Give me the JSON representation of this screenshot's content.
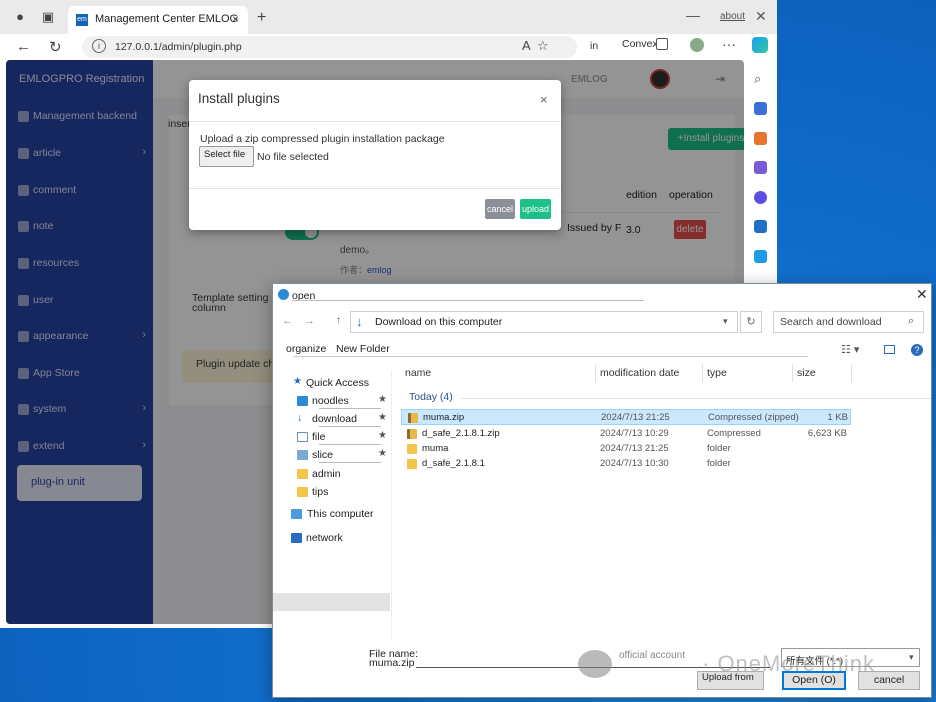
{
  "browser": {
    "tab_title": "Management Center EMLOG",
    "tab_favicon": "em",
    "window_about": "about",
    "url": "127.0.0.1/admin/plugin.php",
    "nav_in": "in",
    "nav_convex": "Convex"
  },
  "sidebar": {
    "title": "EMLOGPRO Registration",
    "items": [
      {
        "label": "Management backend"
      },
      {
        "label": "article",
        "chev": "›"
      },
      {
        "label": "comment"
      },
      {
        "label": "note"
      },
      {
        "label": "resources"
      },
      {
        "label": "user"
      },
      {
        "label": "appearance",
        "chev": "›"
      },
      {
        "label": "App Store"
      },
      {
        "label": "system",
        "chev": "›"
      },
      {
        "label": "extend",
        "chev": "›"
      }
    ],
    "active": "plug-in unit"
  },
  "topbar": {
    "brand": "EMLOG"
  },
  "content": {
    "insert_text": "insert",
    "install_button": "+Install plugins",
    "col_edition": "edition",
    "col_operation": "operation",
    "row1": {
      "issued": "Issued by F",
      "demo": "demo。",
      "author_label": "作者：",
      "author": "emlog",
      "edition": "3.0",
      "delete": "delete"
    },
    "template_setting": "Template setting column",
    "update_check": "Plugin update check for anomalies"
  },
  "modal": {
    "title": "Install plugins",
    "close": "×",
    "desc": "Upload a zip compressed plugin installation package",
    "select_file": "Select file",
    "no_file": "No file selected",
    "cancel": "cancel",
    "upload": "upload"
  },
  "dialog": {
    "title": "open",
    "close": "✕",
    "address": "Download on this computer",
    "search_placeholder": "Search and download",
    "organize": "organize",
    "new_folder": "New Folder",
    "help": "?",
    "nav": [
      {
        "label": "Quick Access"
      },
      {
        "label": "noodles",
        "pin": "★"
      },
      {
        "label": "download",
        "pin": "★"
      },
      {
        "label": "file",
        "pin": "★"
      },
      {
        "label": "slice",
        "pin": "★"
      },
      {
        "label": "admin"
      },
      {
        "label": "tips"
      },
      {
        "label": "This computer"
      },
      {
        "label": "network"
      }
    ],
    "columns": {
      "name": "name",
      "date": "modification date",
      "type": "type",
      "size": "size"
    },
    "group": "Today (4)",
    "files": [
      {
        "name": "muma.zip",
        "date": "2024/7/13 21:25",
        "type": "Compressed (zipped)",
        "size": "1 KB"
      },
      {
        "name": "d_safe_2.1.8.1.zip",
        "date": "2024/7/13 10:29",
        "type": "Compressed",
        "size": "6,623 KB"
      },
      {
        "name": "muma",
        "date": "2024/7/13 21:25",
        "type": "folder",
        "size": ""
      },
      {
        "name": "d_safe_2.1.8.1",
        "date": "2024/7/13 10:30",
        "type": "folder",
        "size": ""
      }
    ],
    "filename_label": "File name:",
    "filename_value": "muma.zip",
    "filter": "所有文件 (*.*)",
    "upload_from": "Upload from",
    "open": "Open (O)",
    "cancel": "cancel"
  },
  "watermark": {
    "account": "official account",
    "brand": "· OneMoreThink"
  }
}
